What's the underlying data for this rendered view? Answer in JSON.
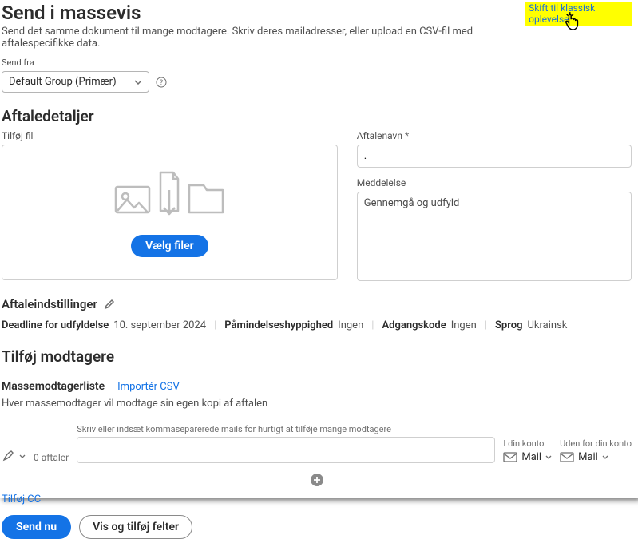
{
  "header": {
    "title": "Send i massevis",
    "subtitle": "Send det samme dokument til mange modtagere. Skriv deres mailadresser, eller upload en CSV-fil med aftalespecifikke data.",
    "classic_link": "Skift til klassisk oplevelse"
  },
  "send_from": {
    "label": "Send fra",
    "selected": "Default Group (Primær)"
  },
  "details": {
    "heading": "Aftaledetaljer",
    "upload_label": "Tilføj fil",
    "choose_files": "Vælg filer",
    "name_label": "Aftalenavn",
    "name_value": ".",
    "message_label": "Meddelelse",
    "message_value": "Gennemgå og udfyld"
  },
  "settings": {
    "heading": "Aftaleindstillinger",
    "items": [
      {
        "k": "Deadline for udfyldelse",
        "v": "10. september 2024"
      },
      {
        "k": "Påmindelseshyppighed",
        "v": "Ingen"
      },
      {
        "k": "Adgangskode",
        "v": "Ingen"
      },
      {
        "k": "Sprog",
        "v": "Ukrainsk"
      }
    ]
  },
  "recipients": {
    "heading": "Tilføj modtagere",
    "bulk_label": "Massemodtagerliste",
    "import_csv": "Importér CSV",
    "bulk_desc": "Hver massemodtager vil modtage sin egen kopi af aftalen",
    "count": "0 aftaler",
    "input_label": "Skriv eller indsæt kommaseparerede mails for hurtigt at tilføje mange modtagere",
    "in_account_label": "I din konto",
    "outside_account_label": "Uden for din konto",
    "mail": "Mail",
    "add_cc": "Tilføj CC"
  },
  "footer": {
    "send": "Send nu",
    "preview": "Vis og tilføj felter"
  }
}
